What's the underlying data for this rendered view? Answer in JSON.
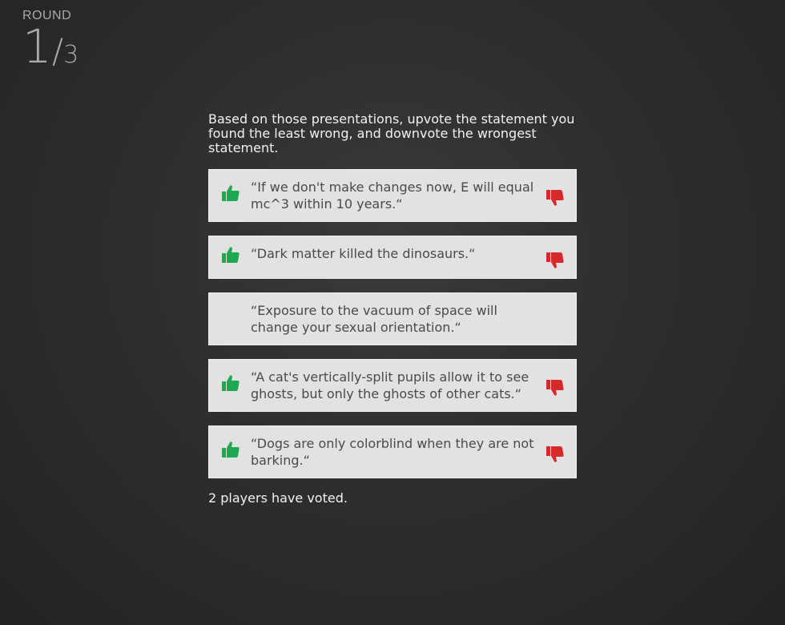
{
  "round": {
    "label": "ROUND",
    "current": "1",
    "separator": "/",
    "total": "3"
  },
  "instructions": "Based on those presentations, upvote the statement you found the least wrong, and downvote the wrongest statement.",
  "statements": [
    {
      "text": "“If we don't make changes now, E will equal mc^3 within 10 years.“",
      "can_vote": true
    },
    {
      "text": "“Dark matter killed the dinosaurs.“",
      "can_vote": true
    },
    {
      "text": "“Exposure to the vacuum of space will change your sexual orientation.“",
      "can_vote": false
    },
    {
      "text": "“A cat's vertically-split pupils allow it to see ghosts, but only the ghosts of other cats.“",
      "can_vote": true
    },
    {
      "text": "“Dogs are only colorblind when they are not barking.“",
      "can_vote": true
    }
  ],
  "vote_status": "2 players have voted.",
  "colors": {
    "upvote": "#1fa84f",
    "downvote": "#d42a2a",
    "card_bg": "#e2e2e2"
  },
  "icons": {
    "upvote": "thumbs-up-icon",
    "downvote": "thumbs-down-icon"
  }
}
